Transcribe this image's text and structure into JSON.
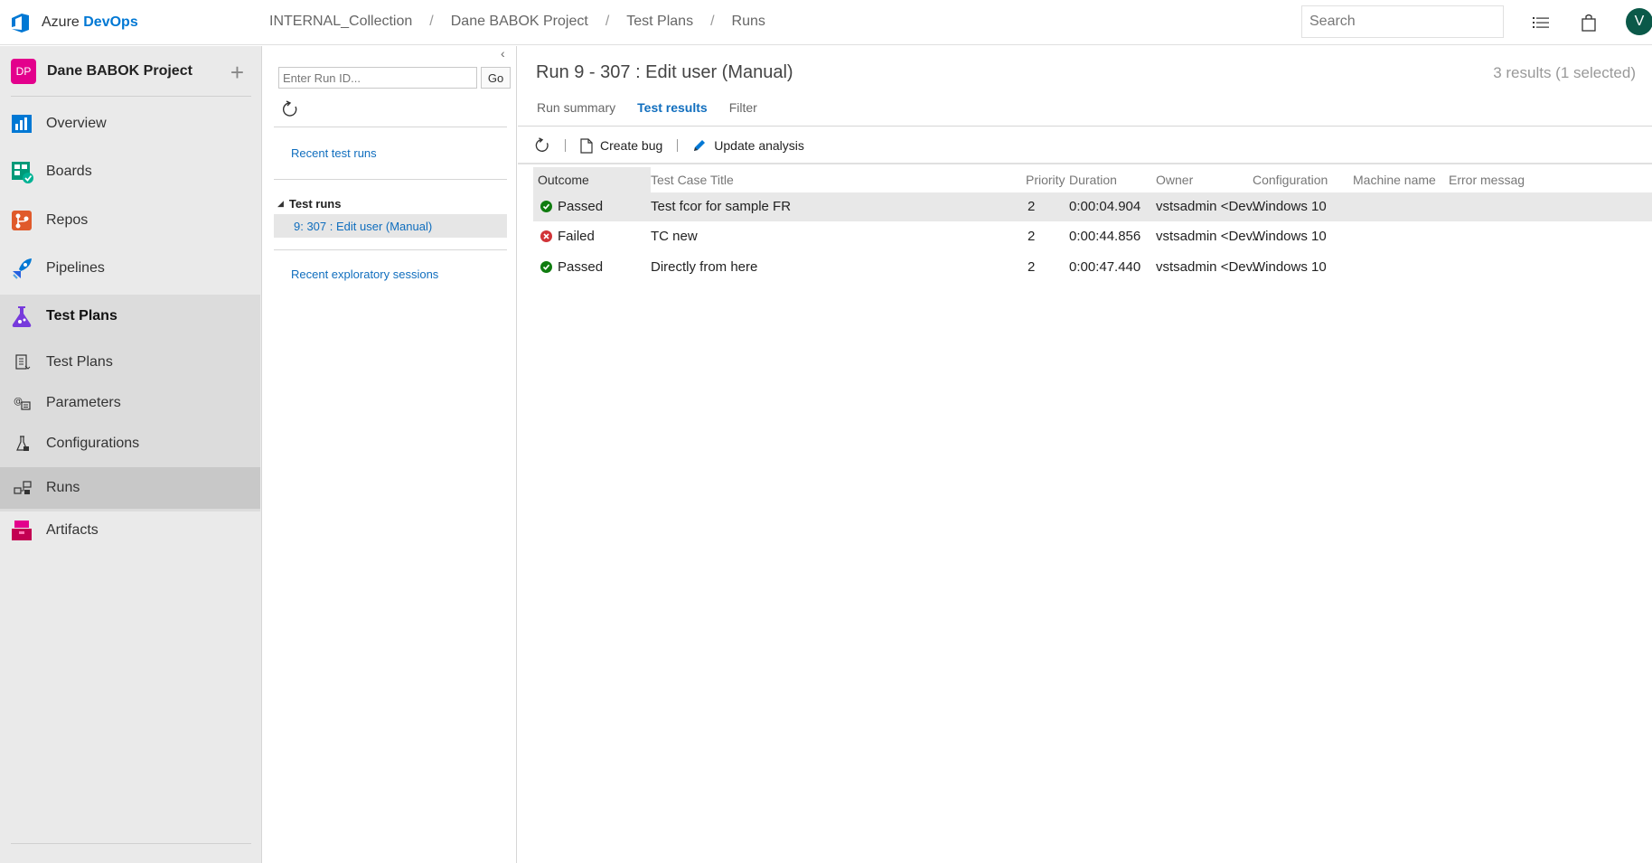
{
  "topbar": {
    "brand_prefix": "Azure",
    "brand_name": "DevOps",
    "breadcrumb": [
      "INTERNAL_Collection",
      "Dane BABOK Project",
      "Test Plans",
      "Runs"
    ],
    "search_placeholder": "Search",
    "avatar_initial": "V"
  },
  "sidebar": {
    "project_initials": "DP",
    "project_name": "Dane BABOK Project",
    "items": [
      {
        "label": "Overview",
        "icon": "overview-icon"
      },
      {
        "label": "Boards",
        "icon": "boards-icon"
      },
      {
        "label": "Repos",
        "icon": "repos-icon"
      },
      {
        "label": "Pipelines",
        "icon": "pipelines-icon"
      },
      {
        "label": "Test Plans",
        "icon": "test-plans-icon"
      },
      {
        "label": "Artifacts",
        "icon": "artifacts-icon"
      }
    ],
    "subitems": [
      {
        "label": "Test Plans",
        "icon": "test-plans-list-icon"
      },
      {
        "label": "Parameters",
        "icon": "parameters-icon"
      },
      {
        "label": "Configurations",
        "icon": "configurations-icon"
      },
      {
        "label": "Runs",
        "icon": "runs-icon"
      }
    ],
    "active_subitem": "Runs"
  },
  "runs_panel": {
    "run_id_placeholder": "Enter Run ID...",
    "go_label": "Go",
    "recent_test_runs": "Recent test runs",
    "test_runs_heading": "Test runs",
    "selected_run": "9: 307 : Edit user (Manual)",
    "recent_exploratory": "Recent exploratory sessions"
  },
  "main": {
    "title": "Run 9 - 307 : Edit user (Manual)",
    "results_count": "3 results (1 selected)",
    "tabs": [
      {
        "label": "Run summary",
        "active": false
      },
      {
        "label": "Test results",
        "active": true
      },
      {
        "label": "Filter",
        "active": false
      }
    ],
    "toolbar": {
      "create_bug": "Create bug",
      "update_analysis": "Update analysis"
    },
    "columns": [
      "Outcome",
      "Test Case Title",
      "Priority",
      "Duration",
      "Owner",
      "Configuration",
      "Machine name",
      "Error messag"
    ],
    "rows": [
      {
        "outcome": "Passed",
        "title": "Test fcor for sample FR",
        "priority": "2",
        "duration": "0:00:04.904",
        "owner": "vstsadmin <Dev...",
        "configuration": "Windows 10",
        "selected": true
      },
      {
        "outcome": "Failed",
        "title": "TC new",
        "priority": "2",
        "duration": "0:00:44.856",
        "owner": "vstsadmin <Dev...",
        "configuration": "Windows 10",
        "selected": false
      },
      {
        "outcome": "Passed",
        "title": "Directly from here",
        "priority": "2",
        "duration": "0:00:47.440",
        "owner": "vstsadmin <Dev...",
        "configuration": "Windows 10",
        "selected": false
      }
    ]
  },
  "colors": {
    "accent": "#0078d4",
    "link": "#106ebe",
    "passed": "#107c10",
    "failed": "#d13438",
    "project_badge": "#e3008c",
    "avatar": "#0b5949"
  }
}
